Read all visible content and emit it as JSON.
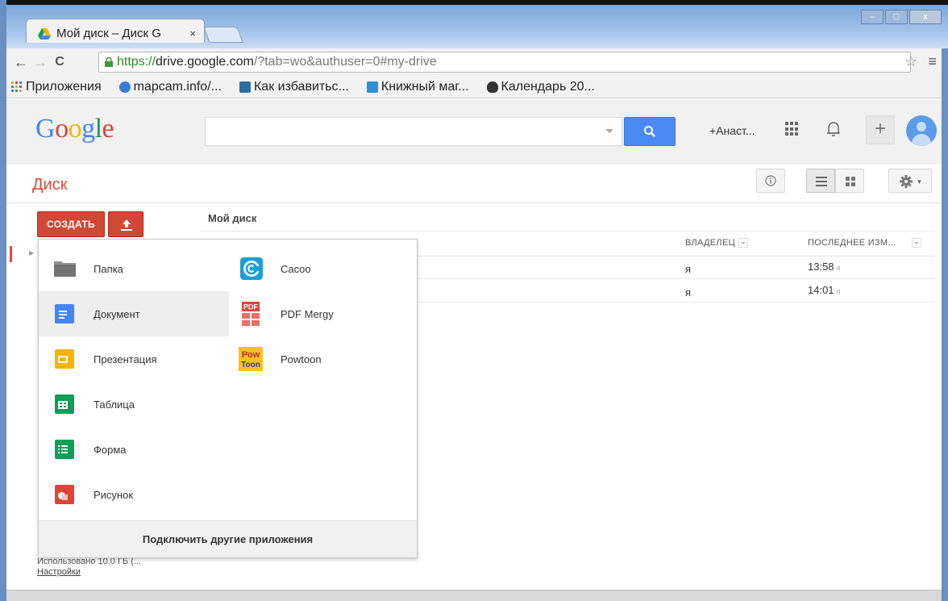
{
  "browser": {
    "tab_title": "Мой диск – Диск G",
    "tab_close": "×",
    "win_minimize": "–",
    "win_maximize": "□",
    "win_close": "x",
    "back": "←",
    "forward": "→",
    "reload": "C",
    "url_scheme": "https://",
    "url_host": "drive.google.com",
    "url_rest": "/?tab=wo&authuser=0#my-drive",
    "star": "☆",
    "menu": "≡"
  },
  "bookmarks": [
    {
      "label": "Приложения",
      "icon": "apps-grid-icon",
      "color": "#e8a33a"
    },
    {
      "label": "mapcam.info/...",
      "icon": "globe-icon",
      "color": "#3a7bd5"
    },
    {
      "label": "Как избавитьс...",
      "icon": "favicon-icon",
      "color": "#2e6da4"
    },
    {
      "label": "Книжный маг...",
      "icon": "bookstore-icon",
      "color": "#2f8fd8"
    },
    {
      "label": "Календарь 20...",
      "icon": "calendar-icon",
      "color": "#333333"
    }
  ],
  "header": {
    "logo": "Google",
    "user": "+Анаст...",
    "plus": "+",
    "bell": "♫"
  },
  "drive": {
    "title": "Диск",
    "info": "i",
    "settings": "✿ ▾",
    "create_label": "СОЗДАТЬ",
    "breadcrumb": "Мой диск",
    "columns": {
      "owner": "ВЛАДЕЛЕЦ",
      "modified": "ПОСЛЕДНЕЕ ИЗМ..."
    },
    "rows": [
      {
        "owner": "я",
        "modified": "13:58",
        "modified_by": "я"
      },
      {
        "owner": "я",
        "modified": "14:01",
        "modified_by": "я"
      }
    ],
    "usage": "Использовано 10,0 ГБ (...",
    "settings_link": "Настройки"
  },
  "menu": {
    "items_left": [
      {
        "label": "Папка",
        "icon": "folder-icon"
      },
      {
        "label": "Документ",
        "icon": "docs-icon"
      },
      {
        "label": "Презентация",
        "icon": "slides-icon"
      },
      {
        "label": "Таблица",
        "icon": "sheets-icon"
      },
      {
        "label": "Форма",
        "icon": "forms-icon"
      },
      {
        "label": "Рисунок",
        "icon": "drawings-icon"
      }
    ],
    "items_right": [
      {
        "label": "Cacoo",
        "icon": "cacoo-icon"
      },
      {
        "label": "PDF Mergy",
        "icon": "pdf-mergy-icon"
      },
      {
        "label": "Powtoon",
        "icon": "powtoon-icon"
      }
    ],
    "footer": "Подключить другие приложения"
  },
  "colors": {
    "accent": "#dd4b39",
    "create": "#d14836",
    "search": "#4a8af4",
    "docs": "#4285f4",
    "slides": "#f4b400",
    "sheets": "#0f9d58",
    "forms": "#0f9d58",
    "drawings": "#db4437"
  }
}
